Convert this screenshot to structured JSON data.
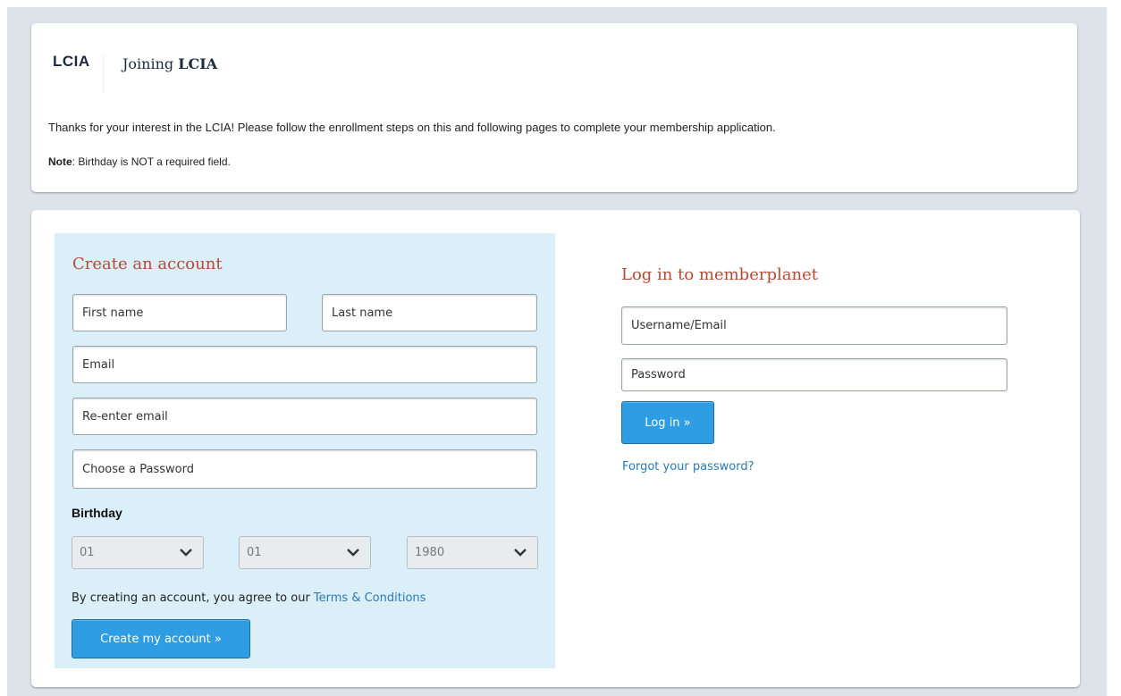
{
  "header": {
    "logo_text": "LCIA",
    "title_prefix": "Joining",
    "title_org": "LCIA",
    "intro": "Thanks for your interest in the LCIA! Please follow the enrollment steps on this and following pages to complete your membership application.",
    "note_label": "Note",
    "note_text": ": Birthday is NOT a required field."
  },
  "create_account": {
    "title": "Create an account",
    "first_name_placeholder": "First name",
    "last_name_placeholder": "Last name",
    "email_placeholder": "Email",
    "reenter_email_placeholder": "Re-enter email",
    "password_placeholder": "Choose a Password",
    "birthday_label": "Birthday",
    "birthday_month": "01",
    "birthday_day": "01",
    "birthday_year": "1980",
    "terms_prefix": "By creating an account, you agree to our ",
    "terms_link": "Terms & Conditions",
    "submit_label": "Create my account »"
  },
  "login": {
    "title": "Log in to memberplanet",
    "username_placeholder": "Username/Email",
    "password_placeholder": "Password",
    "submit_label": "Log in »",
    "forgot_label": "Forgot your password?"
  },
  "colors": {
    "accent_title": "#b44a35",
    "button_blue": "#2e9de3",
    "link_blue": "#2a7ab8",
    "panel_blue": "#dbeff9",
    "page_bg": "#dde3e8"
  }
}
